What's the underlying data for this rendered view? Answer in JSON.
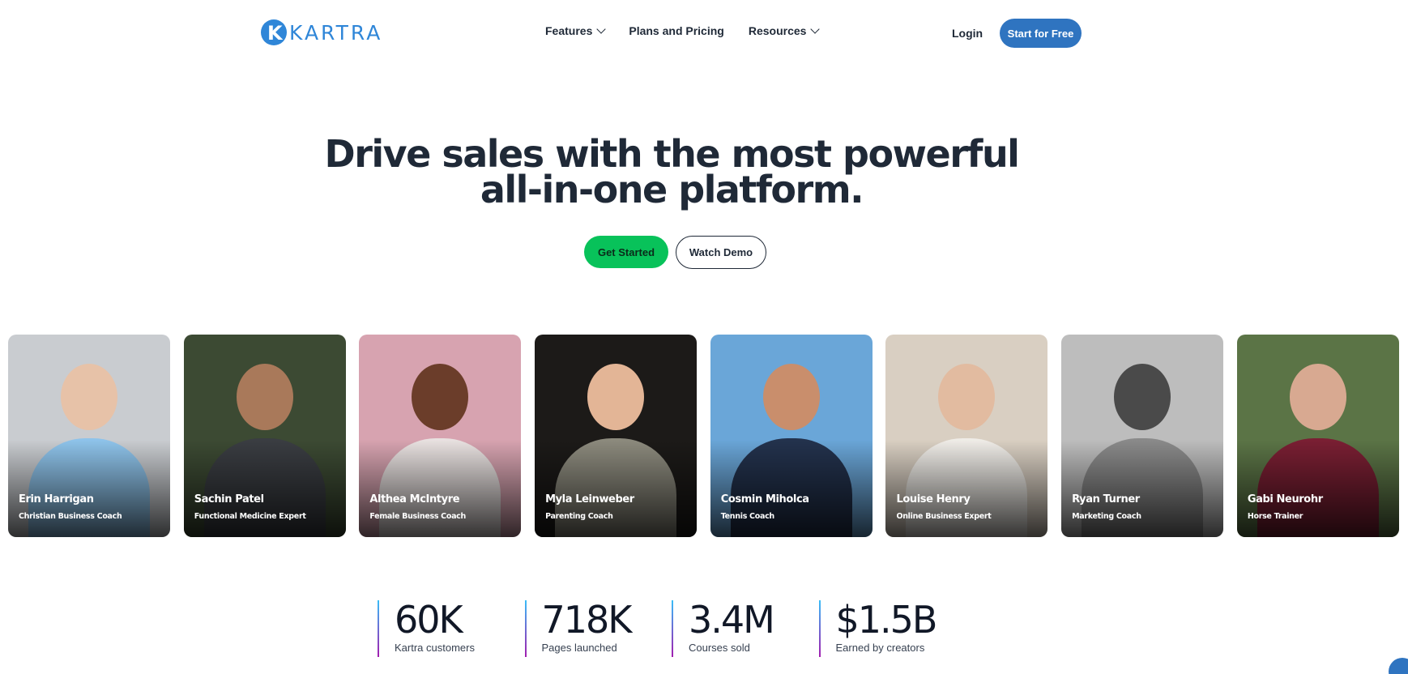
{
  "brand": {
    "name": "KARTRA",
    "mark": "K",
    "color": "#2f86d8"
  },
  "nav": {
    "features": "Features",
    "plans": "Plans and Pricing",
    "resources": "Resources",
    "login": "Login",
    "start_free": "Start for Free"
  },
  "hero": {
    "line1": "Drive sales with the most powerful",
    "line2": "all-in-one platform.",
    "get_started": "Get Started",
    "watch_demo": "Watch Demo"
  },
  "cards": [
    {
      "name": "Erin Harrigan",
      "role": "Christian Business Coach",
      "bg": "#c9ccd0",
      "skin": "#e7c2a8",
      "shirt": "#8ec3ea"
    },
    {
      "name": "Sachin Patel",
      "role": "Functional Medicine Expert",
      "bg": "#3c4a33",
      "skin": "#a9795a",
      "shirt": "#3a3d42"
    },
    {
      "name": "Althea McIntyre",
      "role": "Female Business Coach",
      "bg": "#d7a3b0",
      "skin": "#6b3d2a",
      "shirt": "#e8e1e0"
    },
    {
      "name": "Myla Leinweber",
      "role": "Parenting Coach",
      "bg": "#1c1a18",
      "skin": "#e3b596",
      "shirt": "#8c8a7d"
    },
    {
      "name": "Cosmin Miholca",
      "role": "Tennis Coach",
      "bg": "#6aa6d8",
      "skin": "#c98e6c",
      "shirt": "#23324d"
    },
    {
      "name": "Louise Henry",
      "role": "Online Business Expert",
      "bg": "#d9cfc2",
      "skin": "#e2bba0",
      "shirt": "#efece7"
    },
    {
      "name": "Ryan Turner",
      "role": "Marketing Coach",
      "bg": "#bdbdbd",
      "skin": "#4a4a4a",
      "shirt": "#8a8a8a"
    },
    {
      "name": "Gabi Neurohr",
      "role": "Horse Trainer",
      "bg": "#5b7446",
      "skin": "#d8a991",
      "shirt": "#7a1f33"
    }
  ],
  "stats": [
    {
      "value": "60K",
      "label": "Kartra customers"
    },
    {
      "value": "718K",
      "label": "Pages launched"
    },
    {
      "value": "3.4M",
      "label": "Courses sold"
    },
    {
      "value": "$1.5B",
      "label": "Earned by creators"
    }
  ]
}
